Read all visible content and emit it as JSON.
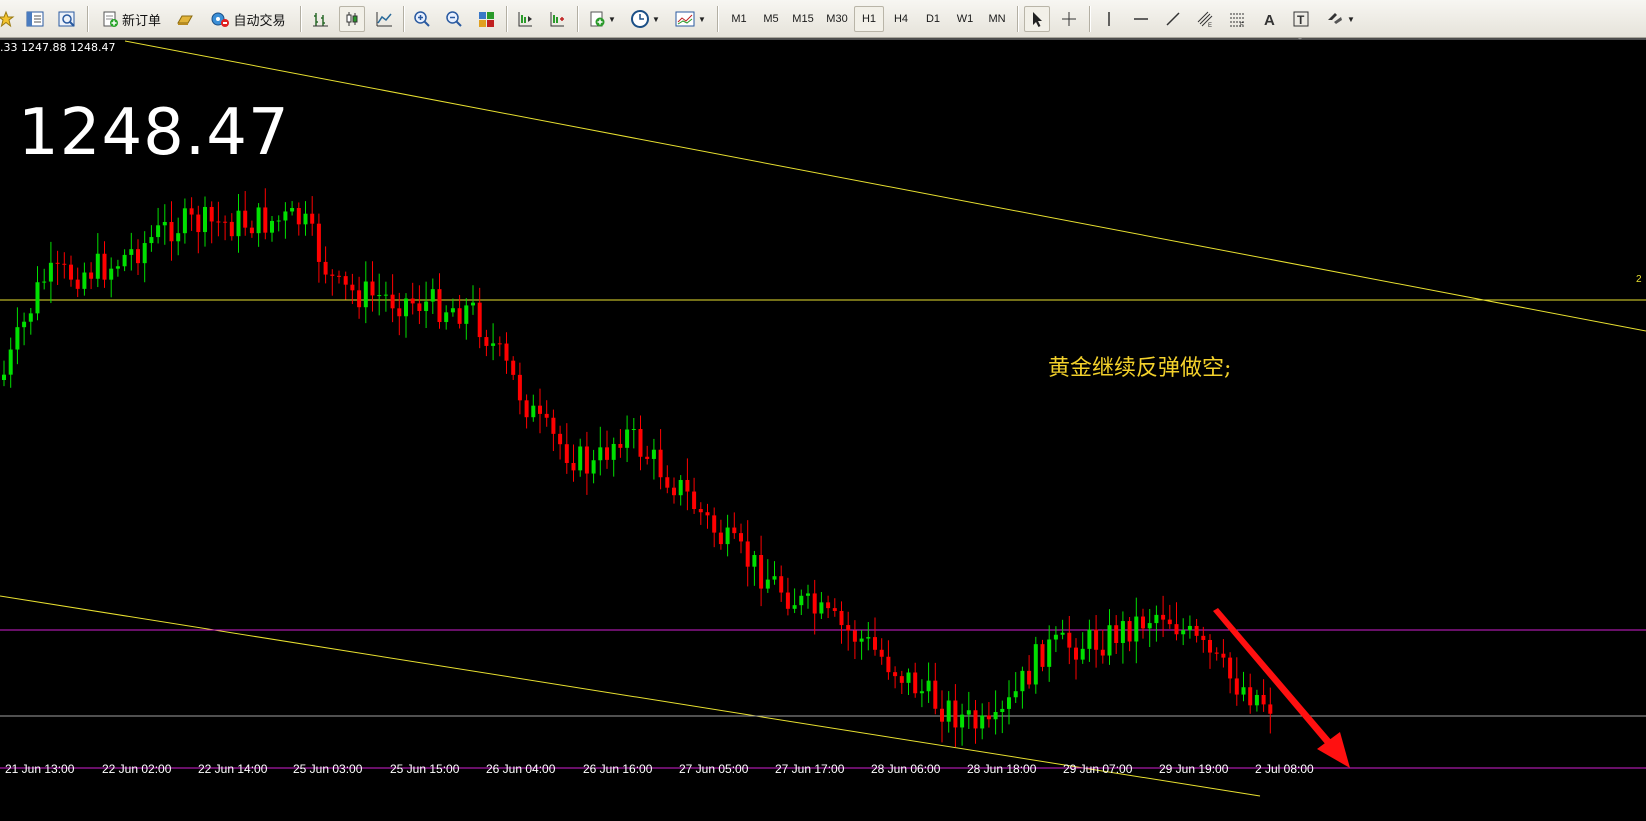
{
  "toolbar": {
    "new_order": "新订单",
    "auto_trading": "自动交易",
    "timeframes": [
      "M1",
      "M5",
      "M15",
      "M30",
      "H1",
      "H4",
      "D1",
      "W1",
      "MN"
    ],
    "active_timeframe": "H1",
    "icons": [
      "favorites-star-icon",
      "market-watch-icon",
      "navigator-icon",
      "new-order-icon",
      "gold-bar-icon",
      "auto-trading-icon",
      "bar-chart-icon",
      "candlesticks-icon",
      "line-chart-icon",
      "zoom-in-icon",
      "zoom-out-icon",
      "tile-windows-icon",
      "chart-shift-icon",
      "auto-scroll-icon",
      "indicators-icon",
      "periods-clock-icon",
      "templates-icon",
      "cursor-icon",
      "crosshair-icon",
      "vertical-line-icon",
      "horizontal-line-icon",
      "trendline-icon",
      "equidistant-channel-icon",
      "fibonacci-icon",
      "text-icon",
      "text-label-icon",
      "arrows-shapes-icon"
    ]
  },
  "chart": {
    "ohlc_text": ".33 1247.88 1248.47",
    "big_price": "1248.47",
    "annotation": "黄金继续反弹做空;",
    "hline_label": "2",
    "time_ticks": [
      "21 Jun 13:00",
      "22 Jun 02:00",
      "22 Jun 14:00",
      "25 Jun 03:00",
      "25 Jun 15:00",
      "26 Jun 04:00",
      "26 Jun 16:00",
      "27 Jun 05:00",
      "27 Jun 17:00",
      "28 Jun 06:00",
      "28 Jun 18:00",
      "29 Jun 07:00",
      "29 Jun 19:00",
      "2 Jul 08:00"
    ],
    "colors": {
      "background": "#000000",
      "bull": "#00e000",
      "bear": "#ff0000",
      "trendline": "#e8e030",
      "support_lines": "#d020d0",
      "gray_line": "#a0a0a0",
      "arrow": "#ff1010"
    }
  }
}
